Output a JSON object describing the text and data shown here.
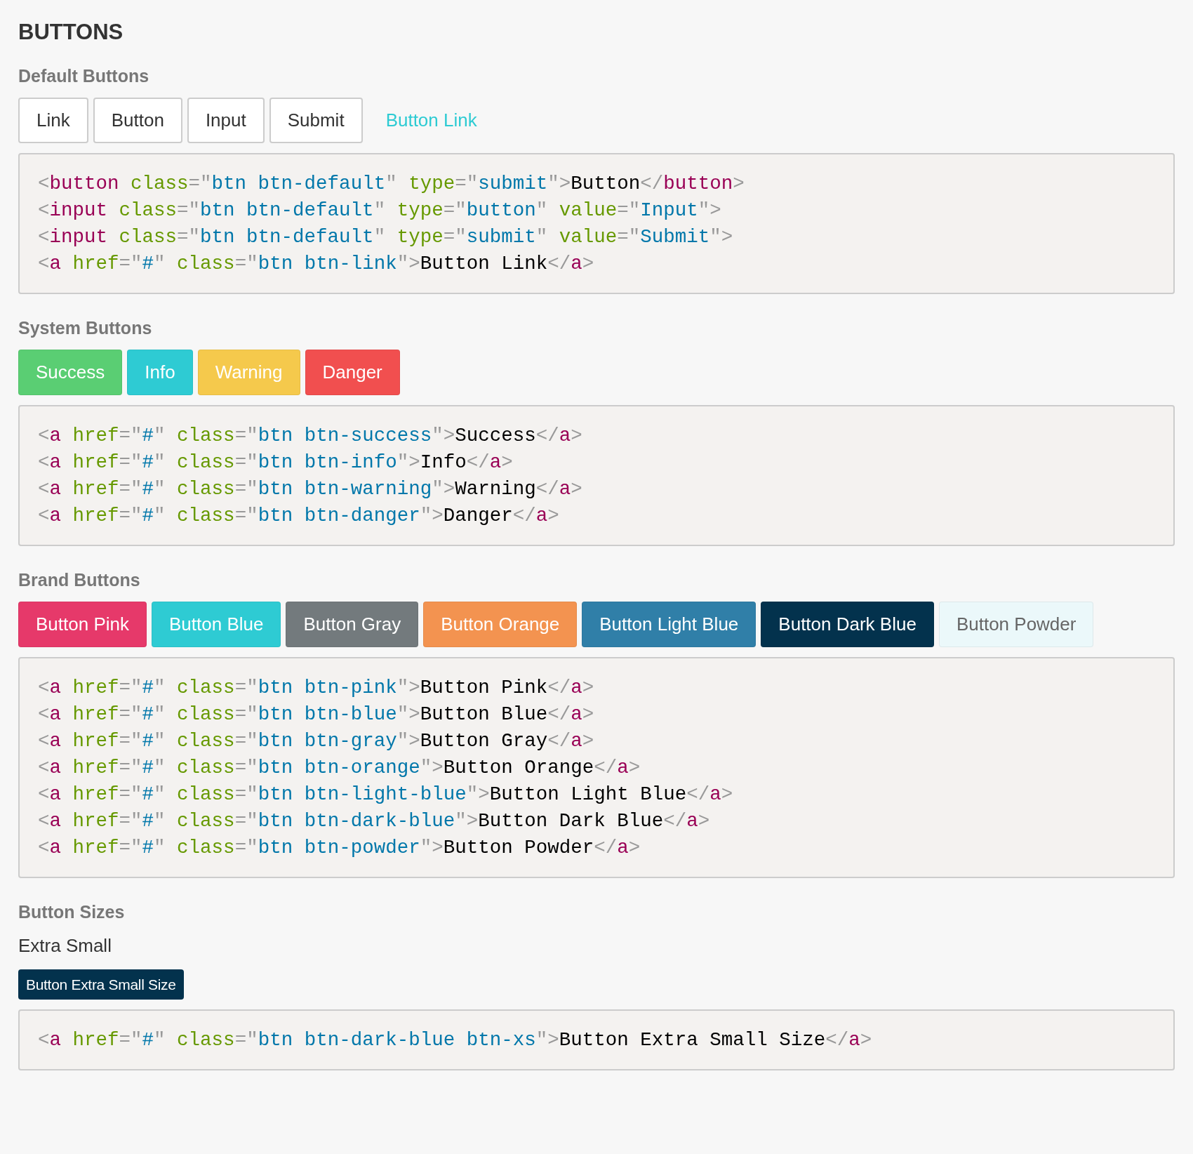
{
  "page_title": "BUTTONS",
  "sections": [
    {
      "heading": "Default Buttons",
      "buttons": [
        {
          "kind": "default",
          "label": "Link"
        },
        {
          "kind": "default",
          "label": "Button"
        },
        {
          "kind": "default",
          "label": "Input"
        },
        {
          "kind": "default",
          "label": "Submit"
        },
        {
          "kind": "link",
          "label": "Button Link"
        }
      ],
      "code": [
        [
          {
            "kind": "p",
            "text": "<"
          },
          {
            "kind": "t",
            "text": "button"
          },
          {
            "kind": "a",
            "text": " class"
          },
          {
            "kind": "p",
            "text": "=\""
          },
          {
            "kind": "s",
            "text": "btn btn-default"
          },
          {
            "kind": "p",
            "text": "\""
          },
          {
            "kind": "a",
            "text": " type"
          },
          {
            "kind": "p",
            "text": "=\""
          },
          {
            "kind": "s",
            "text": "submit"
          },
          {
            "kind": "p",
            "text": "\">"
          },
          {
            "kind": "x",
            "text": "Button"
          },
          {
            "kind": "p",
            "text": "</"
          },
          {
            "kind": "t",
            "text": "button"
          },
          {
            "kind": "p",
            "text": ">"
          }
        ],
        [
          {
            "kind": "p",
            "text": "<"
          },
          {
            "kind": "t",
            "text": "input"
          },
          {
            "kind": "a",
            "text": " class"
          },
          {
            "kind": "p",
            "text": "=\""
          },
          {
            "kind": "s",
            "text": "btn btn-default"
          },
          {
            "kind": "p",
            "text": "\""
          },
          {
            "kind": "a",
            "text": " type"
          },
          {
            "kind": "p",
            "text": "=\""
          },
          {
            "kind": "s",
            "text": "button"
          },
          {
            "kind": "p",
            "text": "\""
          },
          {
            "kind": "a",
            "text": " value"
          },
          {
            "kind": "p",
            "text": "=\""
          },
          {
            "kind": "s",
            "text": "Input"
          },
          {
            "kind": "p",
            "text": "\">"
          }
        ],
        [
          {
            "kind": "p",
            "text": "<"
          },
          {
            "kind": "t",
            "text": "input"
          },
          {
            "kind": "a",
            "text": " class"
          },
          {
            "kind": "p",
            "text": "=\""
          },
          {
            "kind": "s",
            "text": "btn btn-default"
          },
          {
            "kind": "p",
            "text": "\""
          },
          {
            "kind": "a",
            "text": " type"
          },
          {
            "kind": "p",
            "text": "=\""
          },
          {
            "kind": "s",
            "text": "submit"
          },
          {
            "kind": "p",
            "text": "\""
          },
          {
            "kind": "a",
            "text": " value"
          },
          {
            "kind": "p",
            "text": "=\""
          },
          {
            "kind": "s",
            "text": "Submit"
          },
          {
            "kind": "p",
            "text": "\">"
          }
        ],
        [
          {
            "kind": "p",
            "text": "<"
          },
          {
            "kind": "t",
            "text": "a"
          },
          {
            "kind": "a",
            "text": " href"
          },
          {
            "kind": "p",
            "text": "=\""
          },
          {
            "kind": "s",
            "text": "#"
          },
          {
            "kind": "p",
            "text": "\""
          },
          {
            "kind": "a",
            "text": " class"
          },
          {
            "kind": "p",
            "text": "=\""
          },
          {
            "kind": "s",
            "text": "btn btn-link"
          },
          {
            "kind": "p",
            "text": "\">"
          },
          {
            "kind": "x",
            "text": "Button Link"
          },
          {
            "kind": "p",
            "text": "</"
          },
          {
            "kind": "t",
            "text": "a"
          },
          {
            "kind": "p",
            "text": ">"
          }
        ]
      ]
    },
    {
      "heading": "System Buttons",
      "buttons": [
        {
          "kind": "solid",
          "label": "Success",
          "color": "#5ace73"
        },
        {
          "kind": "solid",
          "label": "Info",
          "color": "#2ecbd3"
        },
        {
          "kind": "solid",
          "label": "Warning",
          "color": "#f5c94c"
        },
        {
          "kind": "solid",
          "label": "Danger",
          "color": "#f14f4f"
        }
      ],
      "code": [
        [
          {
            "kind": "p",
            "text": "<"
          },
          {
            "kind": "t",
            "text": "a"
          },
          {
            "kind": "a",
            "text": " href"
          },
          {
            "kind": "p",
            "text": "=\""
          },
          {
            "kind": "s",
            "text": "#"
          },
          {
            "kind": "p",
            "text": "\""
          },
          {
            "kind": "a",
            "text": " class"
          },
          {
            "kind": "p",
            "text": "=\""
          },
          {
            "kind": "s",
            "text": "btn btn-success"
          },
          {
            "kind": "p",
            "text": "\">"
          },
          {
            "kind": "x",
            "text": "Success"
          },
          {
            "kind": "p",
            "text": "</"
          },
          {
            "kind": "t",
            "text": "a"
          },
          {
            "kind": "p",
            "text": ">"
          }
        ],
        [
          {
            "kind": "p",
            "text": "<"
          },
          {
            "kind": "t",
            "text": "a"
          },
          {
            "kind": "a",
            "text": " href"
          },
          {
            "kind": "p",
            "text": "=\""
          },
          {
            "kind": "s",
            "text": "#"
          },
          {
            "kind": "p",
            "text": "\""
          },
          {
            "kind": "a",
            "text": " class"
          },
          {
            "kind": "p",
            "text": "=\""
          },
          {
            "kind": "s",
            "text": "btn btn-info"
          },
          {
            "kind": "p",
            "text": "\">"
          },
          {
            "kind": "x",
            "text": "Info"
          },
          {
            "kind": "p",
            "text": "</"
          },
          {
            "kind": "t",
            "text": "a"
          },
          {
            "kind": "p",
            "text": ">"
          }
        ],
        [
          {
            "kind": "p",
            "text": "<"
          },
          {
            "kind": "t",
            "text": "a"
          },
          {
            "kind": "a",
            "text": " href"
          },
          {
            "kind": "p",
            "text": "=\""
          },
          {
            "kind": "s",
            "text": "#"
          },
          {
            "kind": "p",
            "text": "\""
          },
          {
            "kind": "a",
            "text": " class"
          },
          {
            "kind": "p",
            "text": "=\""
          },
          {
            "kind": "s",
            "text": "btn btn-warning"
          },
          {
            "kind": "p",
            "text": "\">"
          },
          {
            "kind": "x",
            "text": "Warning"
          },
          {
            "kind": "p",
            "text": "</"
          },
          {
            "kind": "t",
            "text": "a"
          },
          {
            "kind": "p",
            "text": ">"
          }
        ],
        [
          {
            "kind": "p",
            "text": "<"
          },
          {
            "kind": "t",
            "text": "a"
          },
          {
            "kind": "a",
            "text": " href"
          },
          {
            "kind": "p",
            "text": "=\""
          },
          {
            "kind": "s",
            "text": "#"
          },
          {
            "kind": "p",
            "text": "\""
          },
          {
            "kind": "a",
            "text": " class"
          },
          {
            "kind": "p",
            "text": "=\""
          },
          {
            "kind": "s",
            "text": "btn btn-danger"
          },
          {
            "kind": "p",
            "text": "\">"
          },
          {
            "kind": "x",
            "text": "Danger"
          },
          {
            "kind": "p",
            "text": "</"
          },
          {
            "kind": "t",
            "text": "a"
          },
          {
            "kind": "p",
            "text": ">"
          }
        ]
      ]
    },
    {
      "heading": "Brand Buttons",
      "buttons": [
        {
          "kind": "solid",
          "label": "Button Pink",
          "color": "#e6396a"
        },
        {
          "kind": "solid",
          "label": "Button Blue",
          "color": "#2ecbd3"
        },
        {
          "kind": "solid",
          "label": "Button Gray",
          "color": "#737a7d"
        },
        {
          "kind": "solid",
          "label": "Button Orange",
          "color": "#f39350"
        },
        {
          "kind": "solid",
          "label": "Button Light Blue",
          "color": "#307fa8"
        },
        {
          "kind": "solid",
          "label": "Button Dark Blue",
          "color": "#03324d"
        },
        {
          "kind": "solid",
          "label": "Button Powder",
          "color": "#ebf8fa"
        }
      ],
      "code": [
        [
          {
            "kind": "p",
            "text": "<"
          },
          {
            "kind": "t",
            "text": "a"
          },
          {
            "kind": "a",
            "text": " href"
          },
          {
            "kind": "p",
            "text": "=\""
          },
          {
            "kind": "s",
            "text": "#"
          },
          {
            "kind": "p",
            "text": "\""
          },
          {
            "kind": "a",
            "text": " class"
          },
          {
            "kind": "p",
            "text": "=\""
          },
          {
            "kind": "s",
            "text": "btn btn-pink"
          },
          {
            "kind": "p",
            "text": "\">"
          },
          {
            "kind": "x",
            "text": "Button Pink"
          },
          {
            "kind": "p",
            "text": "</"
          },
          {
            "kind": "t",
            "text": "a"
          },
          {
            "kind": "p",
            "text": ">"
          }
        ],
        [
          {
            "kind": "p",
            "text": "<"
          },
          {
            "kind": "t",
            "text": "a"
          },
          {
            "kind": "a",
            "text": " href"
          },
          {
            "kind": "p",
            "text": "=\""
          },
          {
            "kind": "s",
            "text": "#"
          },
          {
            "kind": "p",
            "text": "\""
          },
          {
            "kind": "a",
            "text": " class"
          },
          {
            "kind": "p",
            "text": "=\""
          },
          {
            "kind": "s",
            "text": "btn btn-blue"
          },
          {
            "kind": "p",
            "text": "\">"
          },
          {
            "kind": "x",
            "text": "Button Blue"
          },
          {
            "kind": "p",
            "text": "</"
          },
          {
            "kind": "t",
            "text": "a"
          },
          {
            "kind": "p",
            "text": ">"
          }
        ],
        [
          {
            "kind": "p",
            "text": "<"
          },
          {
            "kind": "t",
            "text": "a"
          },
          {
            "kind": "a",
            "text": " href"
          },
          {
            "kind": "p",
            "text": "=\""
          },
          {
            "kind": "s",
            "text": "#"
          },
          {
            "kind": "p",
            "text": "\""
          },
          {
            "kind": "a",
            "text": " class"
          },
          {
            "kind": "p",
            "text": "=\""
          },
          {
            "kind": "s",
            "text": "btn btn-gray"
          },
          {
            "kind": "p",
            "text": "\">"
          },
          {
            "kind": "x",
            "text": "Button Gray"
          },
          {
            "kind": "p",
            "text": "</"
          },
          {
            "kind": "t",
            "text": "a"
          },
          {
            "kind": "p",
            "text": ">"
          }
        ],
        [
          {
            "kind": "p",
            "text": "<"
          },
          {
            "kind": "t",
            "text": "a"
          },
          {
            "kind": "a",
            "text": " href"
          },
          {
            "kind": "p",
            "text": "=\""
          },
          {
            "kind": "s",
            "text": "#"
          },
          {
            "kind": "p",
            "text": "\""
          },
          {
            "kind": "a",
            "text": " class"
          },
          {
            "kind": "p",
            "text": "=\""
          },
          {
            "kind": "s",
            "text": "btn btn-orange"
          },
          {
            "kind": "p",
            "text": "\">"
          },
          {
            "kind": "x",
            "text": "Button Orange"
          },
          {
            "kind": "p",
            "text": "</"
          },
          {
            "kind": "t",
            "text": "a"
          },
          {
            "kind": "p",
            "text": ">"
          }
        ],
        [
          {
            "kind": "p",
            "text": "<"
          },
          {
            "kind": "t",
            "text": "a"
          },
          {
            "kind": "a",
            "text": " href"
          },
          {
            "kind": "p",
            "text": "=\""
          },
          {
            "kind": "s",
            "text": "#"
          },
          {
            "kind": "p",
            "text": "\""
          },
          {
            "kind": "a",
            "text": " class"
          },
          {
            "kind": "p",
            "text": "=\""
          },
          {
            "kind": "s",
            "text": "btn btn-light-blue"
          },
          {
            "kind": "p",
            "text": "\">"
          },
          {
            "kind": "x",
            "text": "Button Light Blue"
          },
          {
            "kind": "p",
            "text": "</"
          },
          {
            "kind": "t",
            "text": "a"
          },
          {
            "kind": "p",
            "text": ">"
          }
        ],
        [
          {
            "kind": "p",
            "text": "<"
          },
          {
            "kind": "t",
            "text": "a"
          },
          {
            "kind": "a",
            "text": " href"
          },
          {
            "kind": "p",
            "text": "=\""
          },
          {
            "kind": "s",
            "text": "#"
          },
          {
            "kind": "p",
            "text": "\""
          },
          {
            "kind": "a",
            "text": " class"
          },
          {
            "kind": "p",
            "text": "=\""
          },
          {
            "kind": "s",
            "text": "btn btn-dark-blue"
          },
          {
            "kind": "p",
            "text": "\">"
          },
          {
            "kind": "x",
            "text": "Button Dark Blue"
          },
          {
            "kind": "p",
            "text": "</"
          },
          {
            "kind": "t",
            "text": "a"
          },
          {
            "kind": "p",
            "text": ">"
          }
        ],
        [
          {
            "kind": "p",
            "text": "<"
          },
          {
            "kind": "t",
            "text": "a"
          },
          {
            "kind": "a",
            "text": " href"
          },
          {
            "kind": "p",
            "text": "=\""
          },
          {
            "kind": "s",
            "text": "#"
          },
          {
            "kind": "p",
            "text": "\""
          },
          {
            "kind": "a",
            "text": " class"
          },
          {
            "kind": "p",
            "text": "=\""
          },
          {
            "kind": "s",
            "text": "btn btn-powder"
          },
          {
            "kind": "p",
            "text": "\">"
          },
          {
            "kind": "x",
            "text": "Button Powder"
          },
          {
            "kind": "p",
            "text": "</"
          },
          {
            "kind": "t",
            "text": "a"
          },
          {
            "kind": "p",
            "text": ">"
          }
        ]
      ]
    },
    {
      "heading": "Button Sizes",
      "sublabel": "Extra Small",
      "buttons": [
        {
          "kind": "xs",
          "label": "Button Extra Small Size",
          "color": "#03324d"
        }
      ],
      "code": [
        [
          {
            "kind": "p",
            "text": "<"
          },
          {
            "kind": "t",
            "text": "a"
          },
          {
            "kind": "a",
            "text": " href"
          },
          {
            "kind": "p",
            "text": "=\""
          },
          {
            "kind": "s",
            "text": "#"
          },
          {
            "kind": "p",
            "text": "\""
          },
          {
            "kind": "a",
            "text": " class"
          },
          {
            "kind": "p",
            "text": "=\""
          },
          {
            "kind": "s",
            "text": "btn btn-dark-blue btn-xs"
          },
          {
            "kind": "p",
            "text": "\">"
          },
          {
            "kind": "x",
            "text": "Button Extra Small Size"
          },
          {
            "kind": "p",
            "text": "</"
          },
          {
            "kind": "t",
            "text": "a"
          },
          {
            "kind": "p",
            "text": ">"
          }
        ]
      ]
    }
  ]
}
